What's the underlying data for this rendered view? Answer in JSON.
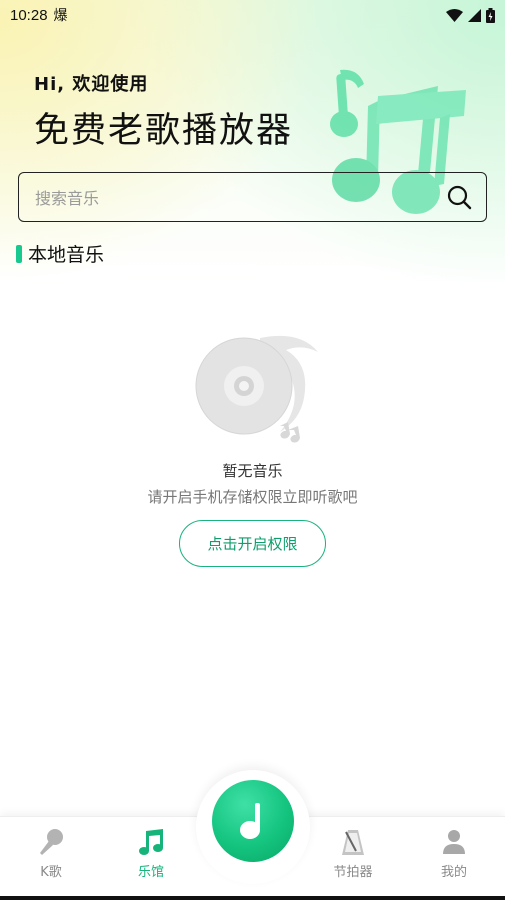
{
  "status_bar": {
    "time": "10:28",
    "extra_glyph": "爆"
  },
  "header": {
    "greeting": "Hi, 欢迎使用",
    "app_title": "免费老歌播放器"
  },
  "search": {
    "placeholder": "搜索音乐"
  },
  "section": {
    "title": "本地音乐"
  },
  "empty_state": {
    "title": "暂无音乐",
    "subtitle": "请开启手机存储权限立即听歌吧",
    "button_label": "点击开启权限"
  },
  "tabbar": {
    "tabs": [
      {
        "label": "K歌",
        "icon": "microphone-icon",
        "active": false
      },
      {
        "label": "乐馆",
        "icon": "music-note-icon",
        "active": true
      },
      {
        "label": "节拍器",
        "icon": "metronome-icon",
        "active": false
      },
      {
        "label": "我的",
        "icon": "person-icon",
        "active": false
      }
    ],
    "center_icon": "play-note-icon"
  },
  "colors": {
    "accent": "#16b47b",
    "accent_light": "#3fe0a6"
  }
}
